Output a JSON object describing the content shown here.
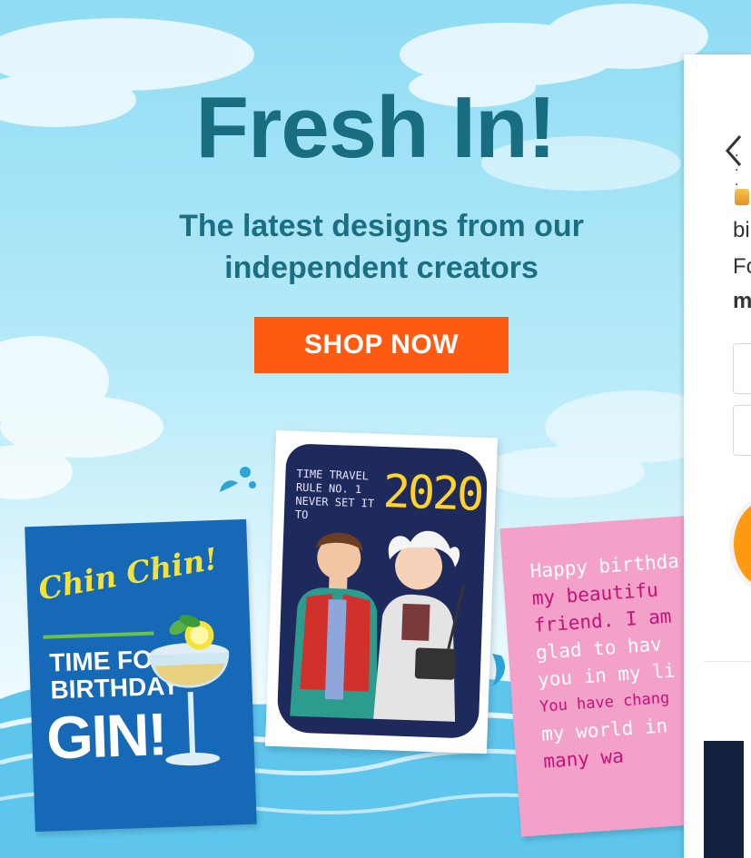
{
  "banner": {
    "headline": "Fresh In!",
    "subline": [
      "The latest designs from our",
      "independent creators"
    ],
    "cta_label": "SHOP NOW"
  },
  "cards": {
    "gin": {
      "script": "Chin Chin!",
      "lines": [
        "TIME FOR",
        "BIRTHDAY"
      ],
      "big": "GIN!"
    },
    "bttf": {
      "small": "TIME TRAVEL RULE NO. 1 NEVER SET IT TO",
      "year": "2020!"
    },
    "happy": {
      "lines": [
        "Happy birthda",
        "my beautifu",
        "friend. I am s",
        "glad to hav",
        "you in my li",
        "You have chang",
        "my world in",
        "many wa"
      ]
    }
  },
  "side_panel": {
    "dots": ". . .",
    "text_1": "bi",
    "text_2": "Fo",
    "text_3": "m"
  },
  "colors": {
    "headline": "#186e80",
    "cta": "#ff5a12",
    "gin_card": "#1669b7",
    "bttf_card": "#1f2a5c",
    "happy_card": "#f3a1c8",
    "happy_highlight": "#c3127a"
  },
  "icons": {
    "back": "chevron-left-icon",
    "splash": "water-splash-icon",
    "glass": "gin-glass-icon"
  }
}
